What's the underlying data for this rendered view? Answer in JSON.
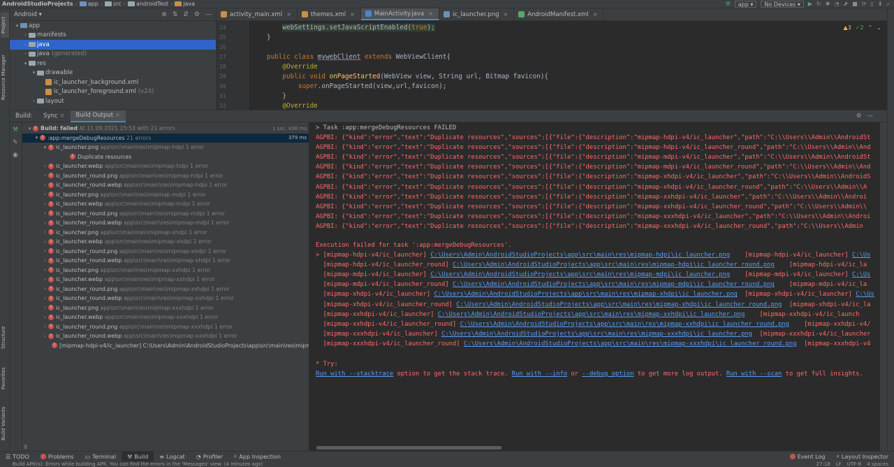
{
  "breadcrumbs": [
    "AndroidStudioProjects",
    "app",
    "src",
    "androidTest",
    "java"
  ],
  "run": {
    "config": "app",
    "device": "No Devices"
  },
  "project_panel": {
    "view": "Android",
    "tree": [
      {
        "label": "app",
        "depth": 0,
        "expanded": true,
        "kind": "module"
      },
      {
        "label": "manifests",
        "depth": 1,
        "expanded": false,
        "kind": "folder"
      },
      {
        "label": "java",
        "depth": 1,
        "expanded": false,
        "kind": "folder",
        "selected": true
      },
      {
        "label": "java",
        "suffix": "(generated)",
        "depth": 1,
        "expanded": false,
        "kind": "folder"
      },
      {
        "label": "res",
        "depth": 1,
        "expanded": true,
        "kind": "folder"
      },
      {
        "label": "drawable",
        "depth": 2,
        "expanded": true,
        "kind": "folder"
      },
      {
        "label": "ic_launcher_background.xml",
        "depth": 3,
        "kind": "xml"
      },
      {
        "label": "ic_launcher_foreground.xml",
        "suffix": "(v24)",
        "depth": 3,
        "kind": "xml"
      },
      {
        "label": "layout",
        "depth": 2,
        "expanded": false,
        "kind": "folder"
      }
    ]
  },
  "editor": {
    "tabs": [
      {
        "label": "activity_main.xml",
        "color": "#c88f48",
        "active": false
      },
      {
        "label": "themes.xml",
        "color": "#c88f48",
        "active": false
      },
      {
        "label": "MainActivity.java",
        "color": "#4a88c7",
        "active": true
      },
      {
        "label": "ic_launcher.png",
        "color": "#6f8fb5",
        "active": false
      },
      {
        "label": "AndroidManifest.xml",
        "color": "#59a869",
        "active": false
      }
    ],
    "warnings": "3",
    "checks": "2",
    "line_numbers": [
      "24",
      "25",
      "26",
      "27",
      "28",
      "29",
      "30",
      "31",
      "32"
    ]
  },
  "build_window": {
    "tabs": [
      "Build:",
      "Sync",
      "Build Output"
    ],
    "summary": {
      "status": "Build: failed",
      "detail": "At 11.09.2021 15:53 with 21 errors",
      "time": "1 sec, 436 ms"
    },
    "task": {
      "label": ":app:mergeDebugResources",
      "count": "21 errors",
      "time": "379 ms"
    },
    "first_file": {
      "name": "ic_launcher.png",
      "path": "app\\src\\main\\res\\mipmap-hdpi 1 error"
    },
    "first_msg": "Duplicate resources",
    "items": [
      {
        "name": "ic_launcher.webp",
        "path": "app\\src\\main\\res\\mipmap-hdpi 1 error"
      },
      {
        "name": "ic_launcher_round.png",
        "path": "app\\src\\main\\res\\mipmap-hdpi 1 error"
      },
      {
        "name": "ic_launcher_round.webp",
        "path": "app\\src\\main\\res\\mipmap-hdpi 1 error"
      },
      {
        "name": "ic_launcher.png",
        "path": "app\\src\\main\\res\\mipmap-mdpi 1 error"
      },
      {
        "name": "ic_launcher.webp",
        "path": "app\\src\\main\\res\\mipmap-mdpi 1 error"
      },
      {
        "name": "ic_launcher_round.png",
        "path": "app\\src\\main\\res\\mipmap-mdpi 1 error"
      },
      {
        "name": "ic_launcher_round.webp",
        "path": "app\\src\\main\\res\\mipmap-mdpi 1 error"
      },
      {
        "name": "ic_launcher.png",
        "path": "app\\src\\main\\res\\mipmap-xhdpi 1 error"
      },
      {
        "name": "ic_launcher.webp",
        "path": "app\\src\\main\\res\\mipmap-xhdpi 1 error"
      },
      {
        "name": "ic_launcher_round.png",
        "path": "app\\src\\main\\res\\mipmap-xhdpi 1 error"
      },
      {
        "name": "ic_launcher_round.webp",
        "path": "app\\src\\main\\res\\mipmap-xhdpi 1 error"
      },
      {
        "name": "ic_launcher.png",
        "path": "app\\src\\main\\res\\mipmap-xxhdpi 1 error"
      },
      {
        "name": "ic_launcher.webp",
        "path": "app\\src\\main\\res\\mipmap-xxhdpi 1 error"
      },
      {
        "name": "ic_launcher_round.png",
        "path": "app\\src\\main\\res\\mipmap-xxhdpi 1 error"
      },
      {
        "name": "ic_launcher_round.webp",
        "path": "app\\src\\main\\res\\mipmap-xxhdpi 1 error"
      },
      {
        "name": "ic_launcher.png",
        "path": "app\\src\\main\\res\\mipmap-xxxhdpi 1 error"
      },
      {
        "name": "ic_launcher.webp",
        "path": "app\\src\\main\\res\\mipmap-xxxhdpi 1 error"
      },
      {
        "name": "ic_launcher_round.png",
        "path": "app\\src\\main\\res\\mipmap-xxxhdpi 1 error"
      },
      {
        "name": "ic_launcher_round.webp",
        "path": "app\\src\\main\\res\\mipmap-xxxhdpi 1 error"
      }
    ],
    "last_error": "[mipmap-hdpi-v4/ic_launcher] C:\\Users\\Admin\\AndroidStudioProjects\\app\\src\\main\\res\\mipmap-h"
  },
  "console": {
    "task_line": "> Task :app:mergeDebugResources FAILED",
    "agpbi": [
      "AGPBI: {\"kind\":\"error\",\"text\":\"Duplicate resources\",\"sources\":[{\"file\":{\"description\":\"mipmap-hdpi-v4/ic_launcher\",\"path\":\"C:\\\\Users\\\\Admin\\\\AndroidSt",
      "AGPBI: {\"kind\":\"error\",\"text\":\"Duplicate resources\",\"sources\":[{\"file\":{\"description\":\"mipmap-hdpi-v4/ic_launcher_round\",\"path\":\"C:\\\\Users\\\\Admin\\\\And",
      "AGPBI: {\"kind\":\"error\",\"text\":\"Duplicate resources\",\"sources\":[{\"file\":{\"description\":\"mipmap-mdpi-v4/ic_launcher\",\"path\":\"C:\\\\Users\\\\Admin\\\\AndroidSt",
      "AGPBI: {\"kind\":\"error\",\"text\":\"Duplicate resources\",\"sources\":[{\"file\":{\"description\":\"mipmap-mdpi-v4/ic_launcher_round\",\"path\":\"C:\\\\Users\\\\Admin\\\\And",
      "AGPBI: {\"kind\":\"error\",\"text\":\"Duplicate resources\",\"sources\":[{\"file\":{\"description\":\"mipmap-xhdpi-v4/ic_launcher\",\"path\":\"C:\\\\Users\\\\Admin\\\\AndroidS",
      "AGPBI: {\"kind\":\"error\",\"text\":\"Duplicate resources\",\"sources\":[{\"file\":{\"description\":\"mipmap-xhdpi-v4/ic_launcher_round\",\"path\":\"C:\\\\Users\\\\Admin\\\\A",
      "AGPBI: {\"kind\":\"error\",\"text\":\"Duplicate resources\",\"sources\":[{\"file\":{\"description\":\"mipmap-xxhdpi-v4/ic_launcher\",\"path\":\"C:\\\\Users\\\\Admin\\\\Androi",
      "AGPBI: {\"kind\":\"error\",\"text\":\"Duplicate resources\",\"sources\":[{\"file\":{\"description\":\"mipmap-xxhdpi-v4/ic_launcher_round\",\"path\":\"C:\\\\Users\\\\Admin\\\\",
      "AGPBI: {\"kind\":\"error\",\"text\":\"Duplicate resources\",\"sources\":[{\"file\":{\"description\":\"mipmap-xxxhdpi-v4/ic_launcher\",\"path\":\"C:\\\\Users\\\\Admin\\\\Androi",
      "AGPBI: {\"kind\":\"error\",\"text\":\"Duplicate resources\",\"sources\":[{\"file\":{\"description\":\"mipmap-xxxhdpi-v4/ic_launcher_round\",\"path\":\"C:\\\\Users\\\\Admin"
    ],
    "exec_failed": "Execution failed for task ':app:mergeDebugResources'.",
    "dup_lines": [
      {
        "prefix": "> [mipmap-hdpi-v4/ic_launcher] ",
        "path": "C:\\Users\\Admin\\AndroidStudioProjects\\app\\src\\main\\res\\mipmap-hdpi\\ic_launcher.png",
        "tail": "    [mipmap-hdpi-v4/ic_launcher] ",
        "tail_link": "C:\\Us"
      },
      {
        "prefix": "  [mipmap-hdpi-v4/ic_launcher_round] ",
        "path": "C:\\Users\\Admin\\AndroidStudioProjects\\app\\src\\main\\res\\mipmap-hdpi\\ic_launcher_round.png",
        "tail": "    [mipmap-hdpi-v4/ic_la",
        "tail_link": ""
      },
      {
        "prefix": "  [mipmap-mdpi-v4/ic_launcher] ",
        "path": "C:\\Users\\Admin\\AndroidStudioProjects\\app\\src\\main\\res\\mipmap-mdpi\\ic_launcher.png",
        "tail": "    [mipmap-mdpi-v4/ic_launcher] ",
        "tail_link": "C:\\Us"
      },
      {
        "prefix": "  [mipmap-mdpi-v4/ic_launcher_round] ",
        "path": "C:\\Users\\Admin\\AndroidStudioProjects\\app\\src\\main\\res\\mipmap-mdpi\\ic_launcher_round.png",
        "tail": "    [mipmap-mdpi-v4/ic_la",
        "tail_link": ""
      },
      {
        "prefix": "  [mipmap-xhdpi-v4/ic_launcher] ",
        "path": "C:\\Users\\Admin\\AndroidStudioProjects\\app\\src\\main\\res\\mipmap-xhdpi\\ic_launcher.png",
        "tail": "  [mipmap-xhdpi-v4/ic_launcher] ",
        "tail_link": "C:\\Us"
      },
      {
        "prefix": "  [mipmap-xhdpi-v4/ic_launcher_round] ",
        "path": "C:\\Users\\Admin\\AndroidStudioProjects\\app\\src\\main\\res\\mipmap-xhdpi\\ic_launcher_round.png",
        "tail": "  [mipmap-xhdpi-v4/ic_la",
        "tail_link": ""
      },
      {
        "prefix": "  [mipmap-xxhdpi-v4/ic_launcher] ",
        "path": "C:\\Users\\Admin\\AndroidStudioProjects\\app\\src\\main\\res\\mipmap-xxhdpi\\ic_launcher.png",
        "tail": "    [mipmap-xxhdpi-v4/ic_launch",
        "tail_link": ""
      },
      {
        "prefix": "  [mipmap-xxhdpi-v4/ic_launcher_round] ",
        "path": "C:\\Users\\Admin\\AndroidStudioProjects\\app\\src\\main\\res\\mipmap-xxhdpi\\ic_launcher_round.png",
        "tail": "    [mipmap-xxhdpi-v4/",
        "tail_link": ""
      },
      {
        "prefix": "  [mipmap-xxxhdpi-v4/ic_launcher] ",
        "path": "C:\\Users\\Admin\\AndroidStudioProjects\\app\\src\\main\\res\\mipmap-xxxhdpi\\ic_launcher.png",
        "tail": "  [mipmap-xxxhdpi-v4/ic_launcher",
        "tail_link": ""
      },
      {
        "prefix": "  [mipmap-xxxhdpi-v4/ic_launcher_round] ",
        "path": "C:\\Users\\Admin\\AndroidStudioProjects\\app\\src\\main\\res\\mipmap-xxxhdpi\\ic_launcher_round.png",
        "tail": "  [mipmap-xxxhdpi-v4",
        "tail_link": ""
      }
    ],
    "try": "* Try:",
    "try_parts": {
      "link1": "Run with --stacktrace",
      "t1": " option to get the stack trace. ",
      "link2": "Run with --info",
      "t2": " or ",
      "link3": "--debug option",
      "t3": " to get more log output. ",
      "link4": "Run with --scan",
      "t4": " to get full insights."
    }
  },
  "bottom_tabs": [
    "TODO",
    "Problems",
    "Terminal",
    "Build",
    "Logcat",
    "Profiler",
    "App Inspection"
  ],
  "bottom_right": [
    "Event Log",
    "Layout Inspector"
  ],
  "status": {
    "message": "Build APK(s): Errors while building APK. You can find the errors in the 'Messages' view. (4 minutes ago)",
    "pos": "27:18",
    "le": "LF",
    "enc": "UTF-8",
    "indent": "4 spaces"
  },
  "side_tabs_left": [
    "Project",
    "Resource Manager",
    "Structure",
    "Favorites",
    "Build Variants"
  ],
  "colors": {
    "error": "#ff6b68",
    "link": "#589df6",
    "accent": "#4a88c7"
  }
}
